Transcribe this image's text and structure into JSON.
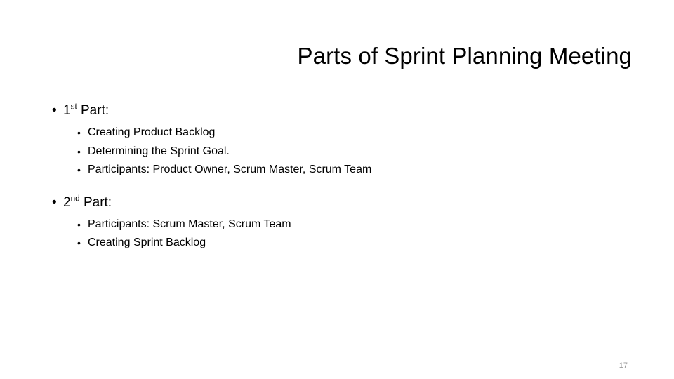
{
  "slide": {
    "title": "Parts of Sprint Planning Meeting",
    "page_number": "17",
    "background_color": "#ffffff",
    "text_color": "#000000",
    "page_number_color": "#9b9b9b",
    "bullet_glyph_level1": "•",
    "bullet_glyph_level2": "•",
    "sections": [
      {
        "heading_number": "1",
        "heading_ordinal_suffix": "st",
        "heading_rest": " Part:",
        "items": [
          "Creating Product Backlog",
          "Determining the Sprint Goal.",
          "Participants: Product Owner, Scrum Master, Scrum Team"
        ]
      },
      {
        "heading_number": "2",
        "heading_ordinal_suffix": "nd",
        "heading_rest": " Part:",
        "items": [
          "Participants: Scrum Master, Scrum Team",
          "Creating Sprint Backlog"
        ]
      }
    ]
  }
}
